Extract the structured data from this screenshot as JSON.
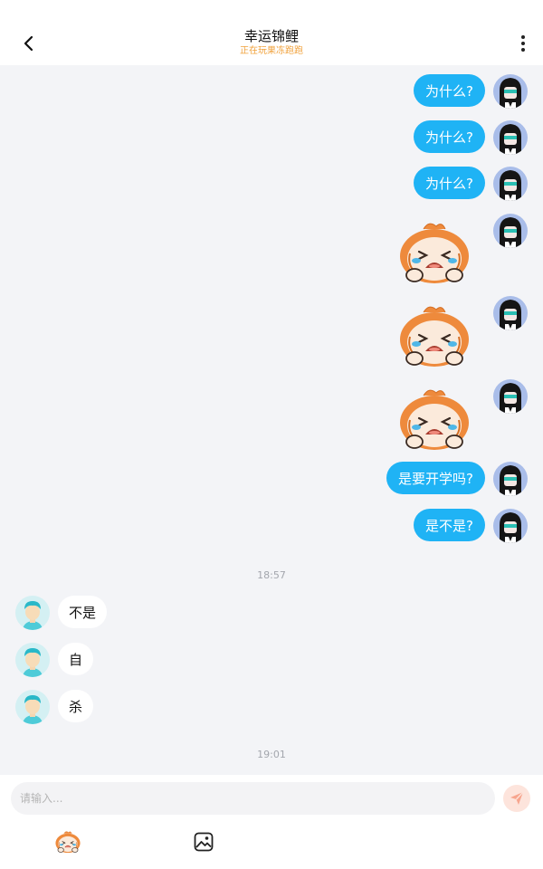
{
  "header": {
    "title": "幸运锦鲤",
    "subtitle": "正在玩果冻跑跑"
  },
  "messages_out": [
    {
      "text": "为什么?"
    },
    {
      "text": "为什么?"
    },
    {
      "text": "为什么?"
    },
    {
      "text": "是要开学吗?"
    },
    {
      "text": "是不是?"
    }
  ],
  "timestamps": [
    "18:57",
    "19:01"
  ],
  "messages_in": [
    {
      "text": "不是"
    },
    {
      "text": "自"
    },
    {
      "text": "杀"
    }
  ],
  "composer": {
    "placeholder": "请输入..."
  },
  "icons": {
    "back": "chevron-left-icon",
    "more": "more-vertical-icon",
    "send": "send-icon",
    "sticker": "sticker-icon",
    "image": "image-icon"
  },
  "colors": {
    "bubble_out": "#1fb3f5",
    "bubble_in": "#ffffff",
    "subtitle": "#f0a13b",
    "background": "#f3f4f7"
  }
}
